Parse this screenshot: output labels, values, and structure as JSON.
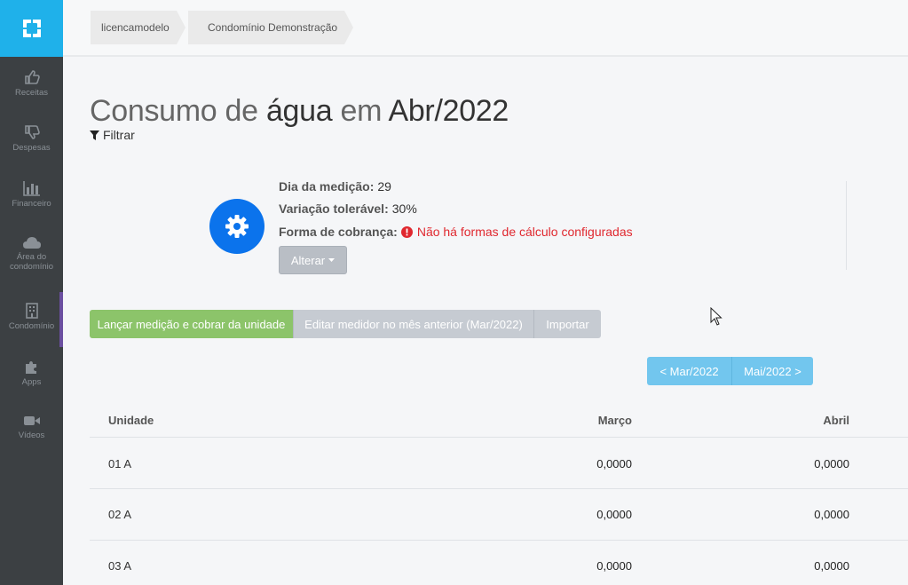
{
  "breadcrumb": [
    "licencamodelo",
    "Condomínio Demonstração"
  ],
  "sidebar": {
    "items": [
      {
        "label": "Receitas",
        "icon": "thumbs-up-icon"
      },
      {
        "label": "Despesas",
        "icon": "thumbs-down-icon"
      },
      {
        "label": "Financeiro",
        "icon": "bar-chart-icon"
      },
      {
        "label": "Área do condomínio",
        "icon": "cloud-icon"
      },
      {
        "label": "Condomínio",
        "icon": "building-icon",
        "active": true
      },
      {
        "label": "Apps",
        "icon": "puzzle-icon"
      },
      {
        "label": "Vídeos",
        "icon": "video-camera-icon"
      }
    ]
  },
  "title": {
    "p1": "Consumo de ",
    "p2": "água",
    "p3": " em ",
    "p4": "Abr/2022"
  },
  "filter_label": "Filtrar",
  "info": {
    "dia_label": "Dia da medição:",
    "dia_value": "29",
    "var_label": "Variação tolerável:",
    "var_value": "30%",
    "forma_label": "Forma de cobrança:",
    "forma_warning": "Não há formas de cálculo configuradas",
    "alterar_label": "Alterar"
  },
  "actions": {
    "lancar": "Lançar medição e cobrar da unidade",
    "editar": "Editar medidor no mês anterior (Mar/2022)",
    "importar": "Importar"
  },
  "month_nav": {
    "prev": "< Mar/2022",
    "next": "Mai/2022 >"
  },
  "table": {
    "headers": [
      "Unidade",
      "Março",
      "Abril"
    ],
    "rows": [
      [
        "01 A",
        "0,0000",
        "0,0000"
      ],
      [
        "02 A",
        "0,0000",
        "0,0000"
      ],
      [
        "03 A",
        "0,0000",
        "0,0000"
      ]
    ]
  },
  "colors": {
    "sidebar": "#3c4043",
    "logo_bg": "#1fb1ea",
    "gear_bg": "#0b73ec",
    "green": "#8cc46a",
    "gray_btn": "#c6cbd2",
    "month_btn": "#72c6ee",
    "warning": "#e0282f"
  }
}
